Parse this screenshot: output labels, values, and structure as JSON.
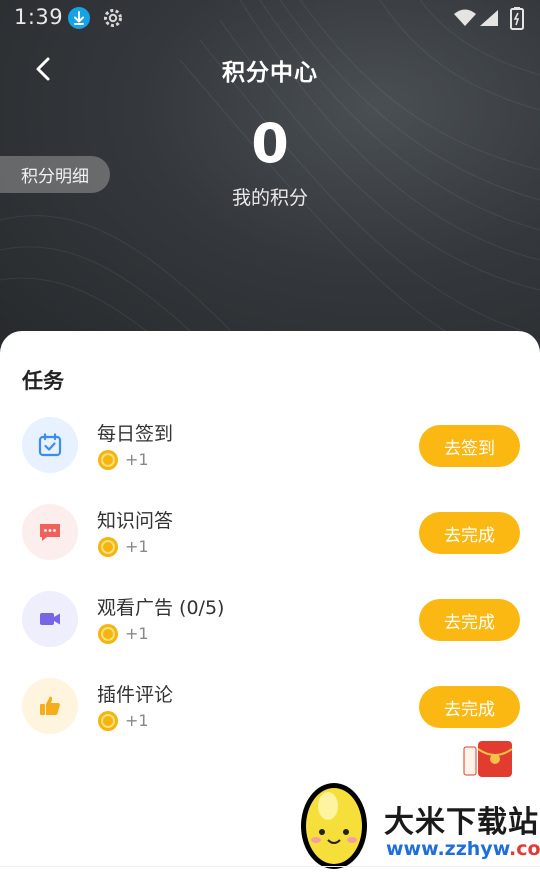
{
  "status_bar": {
    "time": "1:39"
  },
  "header": {
    "title": "积分中心"
  },
  "points": {
    "value": "0",
    "label": "我的积分"
  },
  "detail_button": {
    "label": "积分明细"
  },
  "tasks_section": {
    "title": "任务",
    "tasks": [
      {
        "name": "每日签到",
        "reward": "+1",
        "button": "去签到",
        "icon": "calendar-icon",
        "icon_bg": "#e8f1ff",
        "icon_color": "#3d8cf0"
      },
      {
        "name": "知识问答",
        "reward": "+1",
        "button": "去完成",
        "icon": "chat-bubble-icon",
        "icon_bg": "#fdeeee",
        "icon_color": "#f2605c"
      },
      {
        "name": "观看广告 (0/5)",
        "reward": "+1",
        "button": "去完成",
        "icon": "video-icon",
        "icon_bg": "#eeeefc",
        "icon_color": "#7665e6"
      },
      {
        "name": "插件评论",
        "reward": "+1",
        "button": "去完成",
        "icon": "thumbs-up-icon",
        "icon_bg": "#fff5df",
        "icon_color": "#f6ad1c"
      }
    ]
  },
  "watermark": {
    "name": "大米下载站",
    "url_main": "www.zzhyw",
    "url_tld": ".com"
  },
  "colors": {
    "accent": "#fcb812",
    "hero_bg": "#2b2e31"
  }
}
